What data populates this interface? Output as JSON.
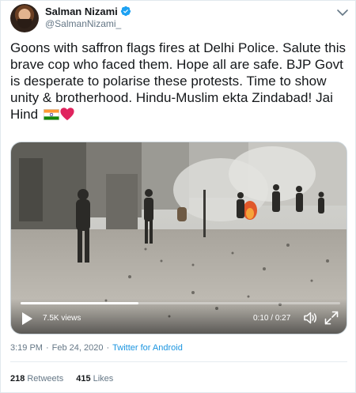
{
  "author": {
    "display_name": "Salman Nizami",
    "handle": "@SalmanNizami_",
    "verified": true
  },
  "tweet": {
    "text": "Goons with saffron flags fires at Delhi Police. Salute this brave cop who faced them. Hope all are safe. BJP Govt is desperate to polarise these protests. Time to show unity & brotherhood. Hindu-Muslim ekta Zindabad! Jai Hind",
    "emoji": [
      "india-flag",
      "red-heart"
    ]
  },
  "video": {
    "views": "7.5K views",
    "current_time": "0:10",
    "duration": "0:27",
    "progress_fraction": 0.37
  },
  "meta": {
    "time": "3:19 PM",
    "separator": "·",
    "date": "Feb 24, 2020",
    "separator2": "·",
    "source": "Twitter for Android"
  },
  "stats": {
    "retweets_count": "218",
    "retweets_label": "Retweets",
    "likes_count": "415",
    "likes_label": "Likes"
  },
  "colors": {
    "text_primary": "#14171a",
    "text_secondary": "#657786",
    "link": "#1b95e0",
    "verified_blue": "#1da1f2",
    "heart_red": "#e0245e"
  }
}
